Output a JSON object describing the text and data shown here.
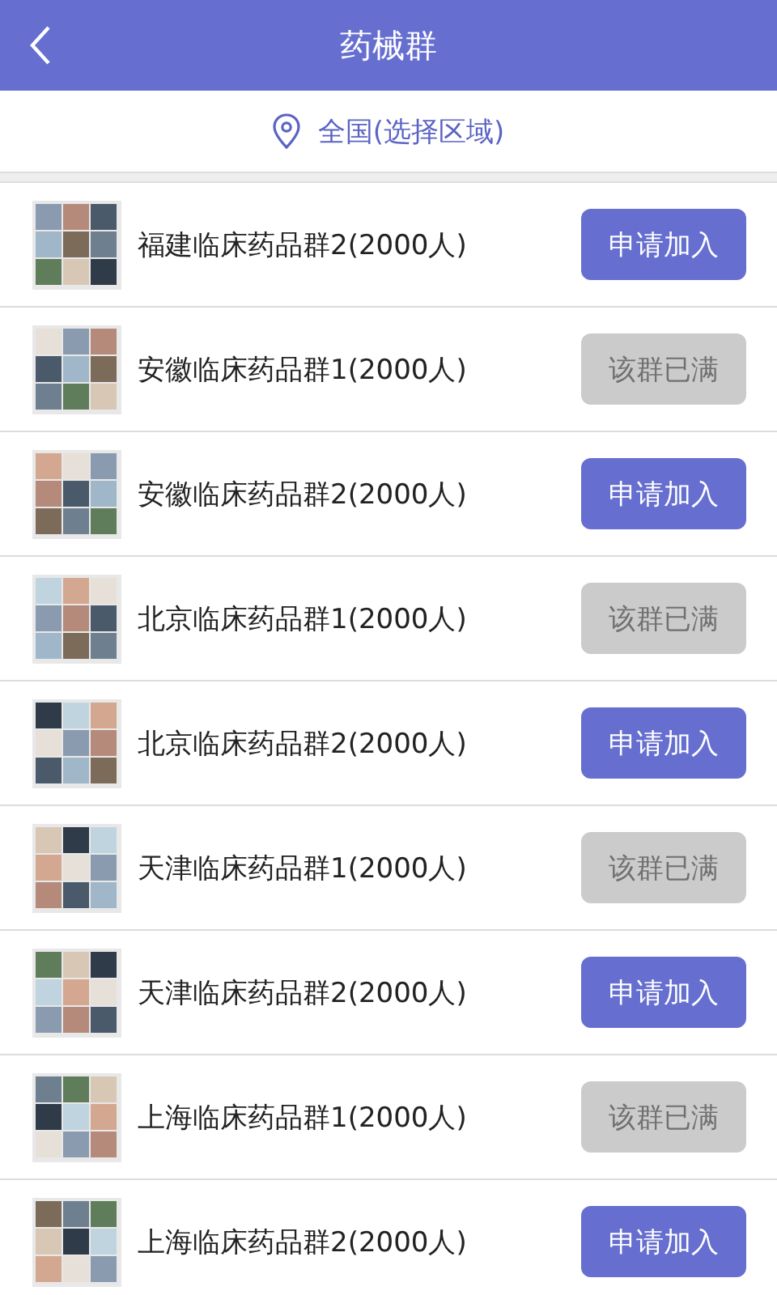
{
  "header": {
    "title": "药械群"
  },
  "region": {
    "label": "全国(选择区域)"
  },
  "groups": [
    {
      "name": "福建临床药品群2(2000人)",
      "button": "申请加入",
      "full": false
    },
    {
      "name": "安徽临床药品群1(2000人)",
      "button": "该群已满",
      "full": true
    },
    {
      "name": "安徽临床药品群2(2000人)",
      "button": "申请加入",
      "full": false
    },
    {
      "name": "北京临床药品群1(2000人)",
      "button": "该群已满",
      "full": true
    },
    {
      "name": "北京临床药品群2(2000人)",
      "button": "申请加入",
      "full": false
    },
    {
      "name": "天津临床药品群1(2000人)",
      "button": "该群已满",
      "full": true
    },
    {
      "name": "天津临床药品群2(2000人)",
      "button": "申请加入",
      "full": false
    },
    {
      "name": "上海临床药品群1(2000人)",
      "button": "该群已满",
      "full": true
    },
    {
      "name": "上海临床药品群2(2000人)",
      "button": "申请加入",
      "full": false
    }
  ]
}
